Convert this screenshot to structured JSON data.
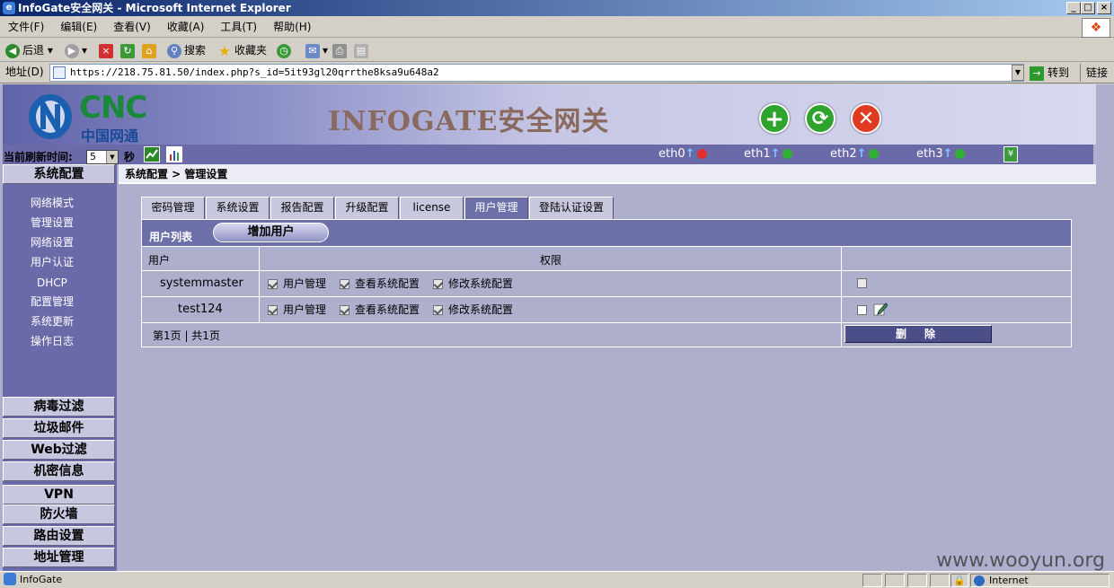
{
  "window": {
    "title": "InfoGate安全网关 - Microsoft Internet Explorer",
    "btn_min": "_",
    "btn_max": "□",
    "btn_close": "×"
  },
  "menu": [
    "文件(F)",
    "编辑(E)",
    "查看(V)",
    "收藏(A)",
    "工具(T)",
    "帮助(H)"
  ],
  "toolbar": {
    "back": "后退",
    "search": "搜索",
    "favorites": "收藏夹"
  },
  "address": {
    "label": "地址(D)",
    "url": "https://218.75.81.50/index.php?s_id=5it93gl20qrrthe8ksa9u648a2",
    "go": "转到",
    "links": "链接"
  },
  "header": {
    "cnc_name": "CNC",
    "cnc_cn": "中国网通",
    "brand": "INFOGATE安全网关"
  },
  "status": {
    "refresh_label": "当前刷新时间:",
    "refresh_value": "5",
    "seconds": "秒",
    "eth": [
      {
        "name": "eth0",
        "led": "#e03030"
      },
      {
        "name": "eth1",
        "led": "#30b030"
      },
      {
        "name": "eth2",
        "led": "#30b030"
      },
      {
        "name": "eth3",
        "led": "#30b030"
      }
    ]
  },
  "sidebar": {
    "top": "系统配置",
    "items": [
      "网络模式",
      "管理设置",
      "网络设置",
      "用户认证",
      "DHCP",
      "配置管理",
      "系统更新",
      "操作日志"
    ],
    "sections": [
      "病毒过滤",
      "垃圾邮件",
      "Web过滤",
      "机密信息",
      "VPN",
      "防火墙",
      "路由设置",
      "地址管理"
    ]
  },
  "breadcrumb": "系统配置 > 管理设置",
  "tabs": [
    "密码管理",
    "系统设置",
    "报告配置",
    "升级配置",
    "license",
    "用户管理",
    "登陆认证设置"
  ],
  "active_tab": "用户管理",
  "panel": {
    "title": "用户列表",
    "add_button": "增加用户",
    "col_user": "用户",
    "col_perm": "权限",
    "rows": [
      {
        "user": "systemmaster",
        "perms": [
          "用户管理",
          "查看系统配置",
          "修改系统配置"
        ],
        "editable": false
      },
      {
        "user": "test124",
        "perms": [
          "用户管理",
          "查看系统配置",
          "修改系统配置"
        ],
        "editable": true
      }
    ],
    "pager": "第1页 | 共1页",
    "delete_button": "删除"
  },
  "statusbar": {
    "text": "InfoGate",
    "zone": "Internet"
  },
  "watermark": "www.wooyun.org"
}
